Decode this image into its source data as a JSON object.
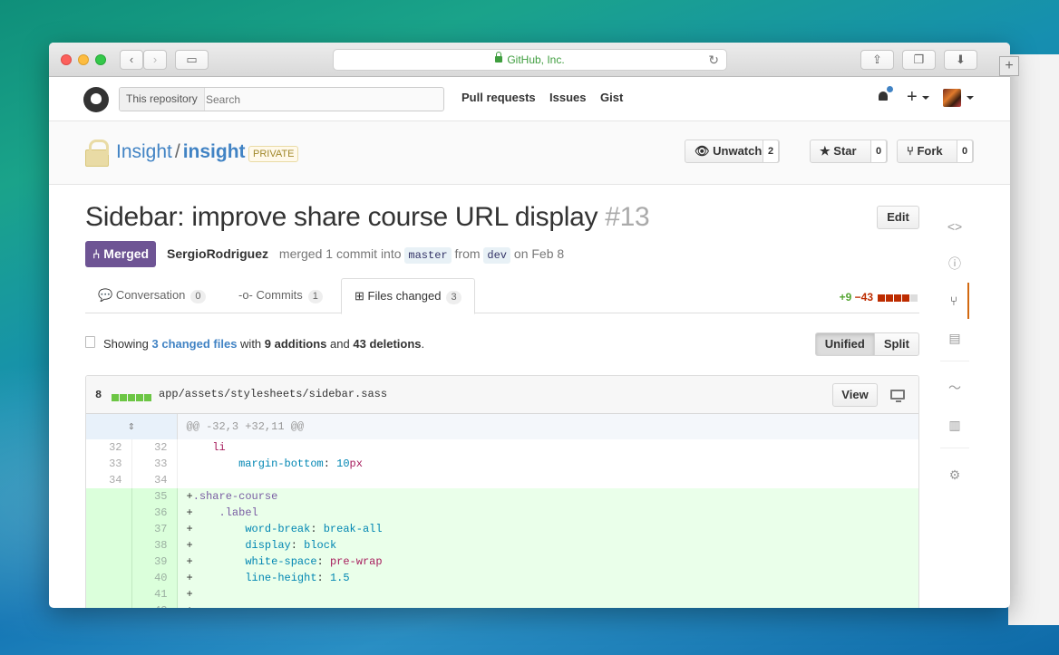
{
  "browser": {
    "url_label": "GitHub, Inc."
  },
  "header": {
    "search_scope": "This repository",
    "search_placeholder": "Search",
    "nav": [
      "Pull requests",
      "Issues",
      "Gist"
    ]
  },
  "repo": {
    "owner": "Insight",
    "name": "insight",
    "visibility": "PRIVATE",
    "unwatch_label": "Unwatch",
    "unwatch_count": "2",
    "star_label": "Star",
    "star_count": "0",
    "fork_label": "Fork",
    "fork_count": "0"
  },
  "pr": {
    "title": "Sidebar: improve share course URL display",
    "number": "#13",
    "edit_label": "Edit",
    "state": "Merged",
    "author": "SergioRodriguez",
    "meta_text": "merged 1 commit into",
    "base_branch": "master",
    "from_text": "from",
    "head_branch": "dev",
    "date_text": "on Feb 8"
  },
  "tabs": [
    {
      "label": "Conversation",
      "count": "0"
    },
    {
      "label": "Commits",
      "count": "1"
    },
    {
      "label": "Files changed",
      "count": "3"
    }
  ],
  "diffstat": {
    "additions": "+9",
    "deletions": "−43"
  },
  "toc": {
    "showing": "Showing",
    "changed_files": "3 changed files",
    "with": "with",
    "additions": "9 additions",
    "and": "and",
    "deletions": "43 deletions",
    "period": "."
  },
  "view_toggle": {
    "unified": "Unified",
    "split": "Split"
  },
  "file": {
    "change_count": "8",
    "path": "app/assets/stylesheets/sidebar.sass",
    "view_label": "View",
    "hunk_header": "@@ -32,3 +32,11 @@"
  },
  "colors": {
    "link": "#4183c4",
    "merged": "#6e5494",
    "addition": "#55a532",
    "deletion": "#bd2c00"
  }
}
